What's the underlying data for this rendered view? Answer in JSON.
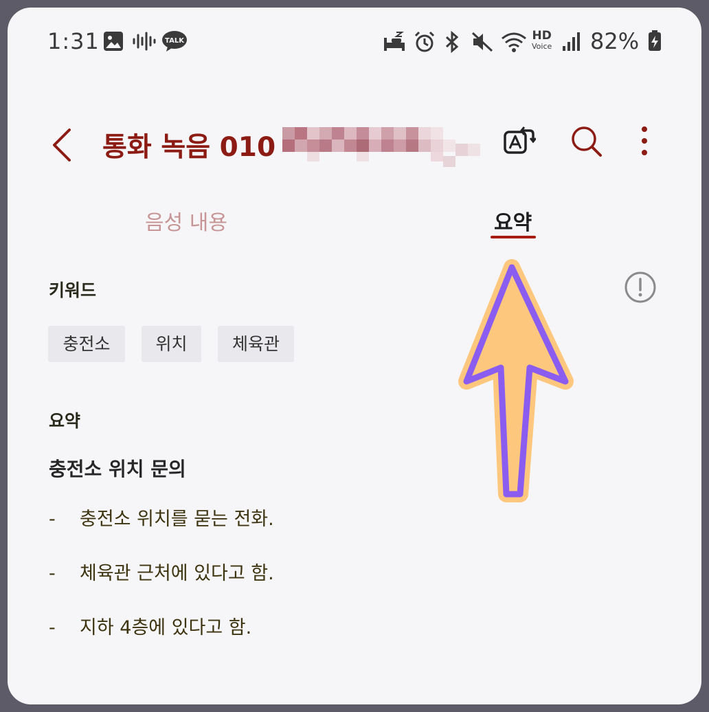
{
  "status_bar": {
    "time": "1:31",
    "battery": "82%",
    "hd_top": "HD",
    "hd_bottom": "Voice",
    "kakao": "TALK"
  },
  "header": {
    "title": "통화 녹음 010",
    "icons": [
      "back-icon",
      "translate-icon",
      "search-icon",
      "more-icon"
    ],
    "accent": "#8c1c13"
  },
  "tabs": [
    {
      "label": "음성 내용",
      "selected": false
    },
    {
      "label": "요약",
      "selected": true
    }
  ],
  "keywords": {
    "heading": "키워드",
    "chips": [
      "충전소",
      "위치",
      "체육관"
    ]
  },
  "summary": {
    "heading": "요약",
    "subtitle": "충전소 위치 문의",
    "bullets": [
      "충전소 위치를 묻는 전화.",
      "체육관 근처에 있다고 함.",
      "지하 4층에 있다고 함."
    ],
    "bullet_marker": "-"
  }
}
